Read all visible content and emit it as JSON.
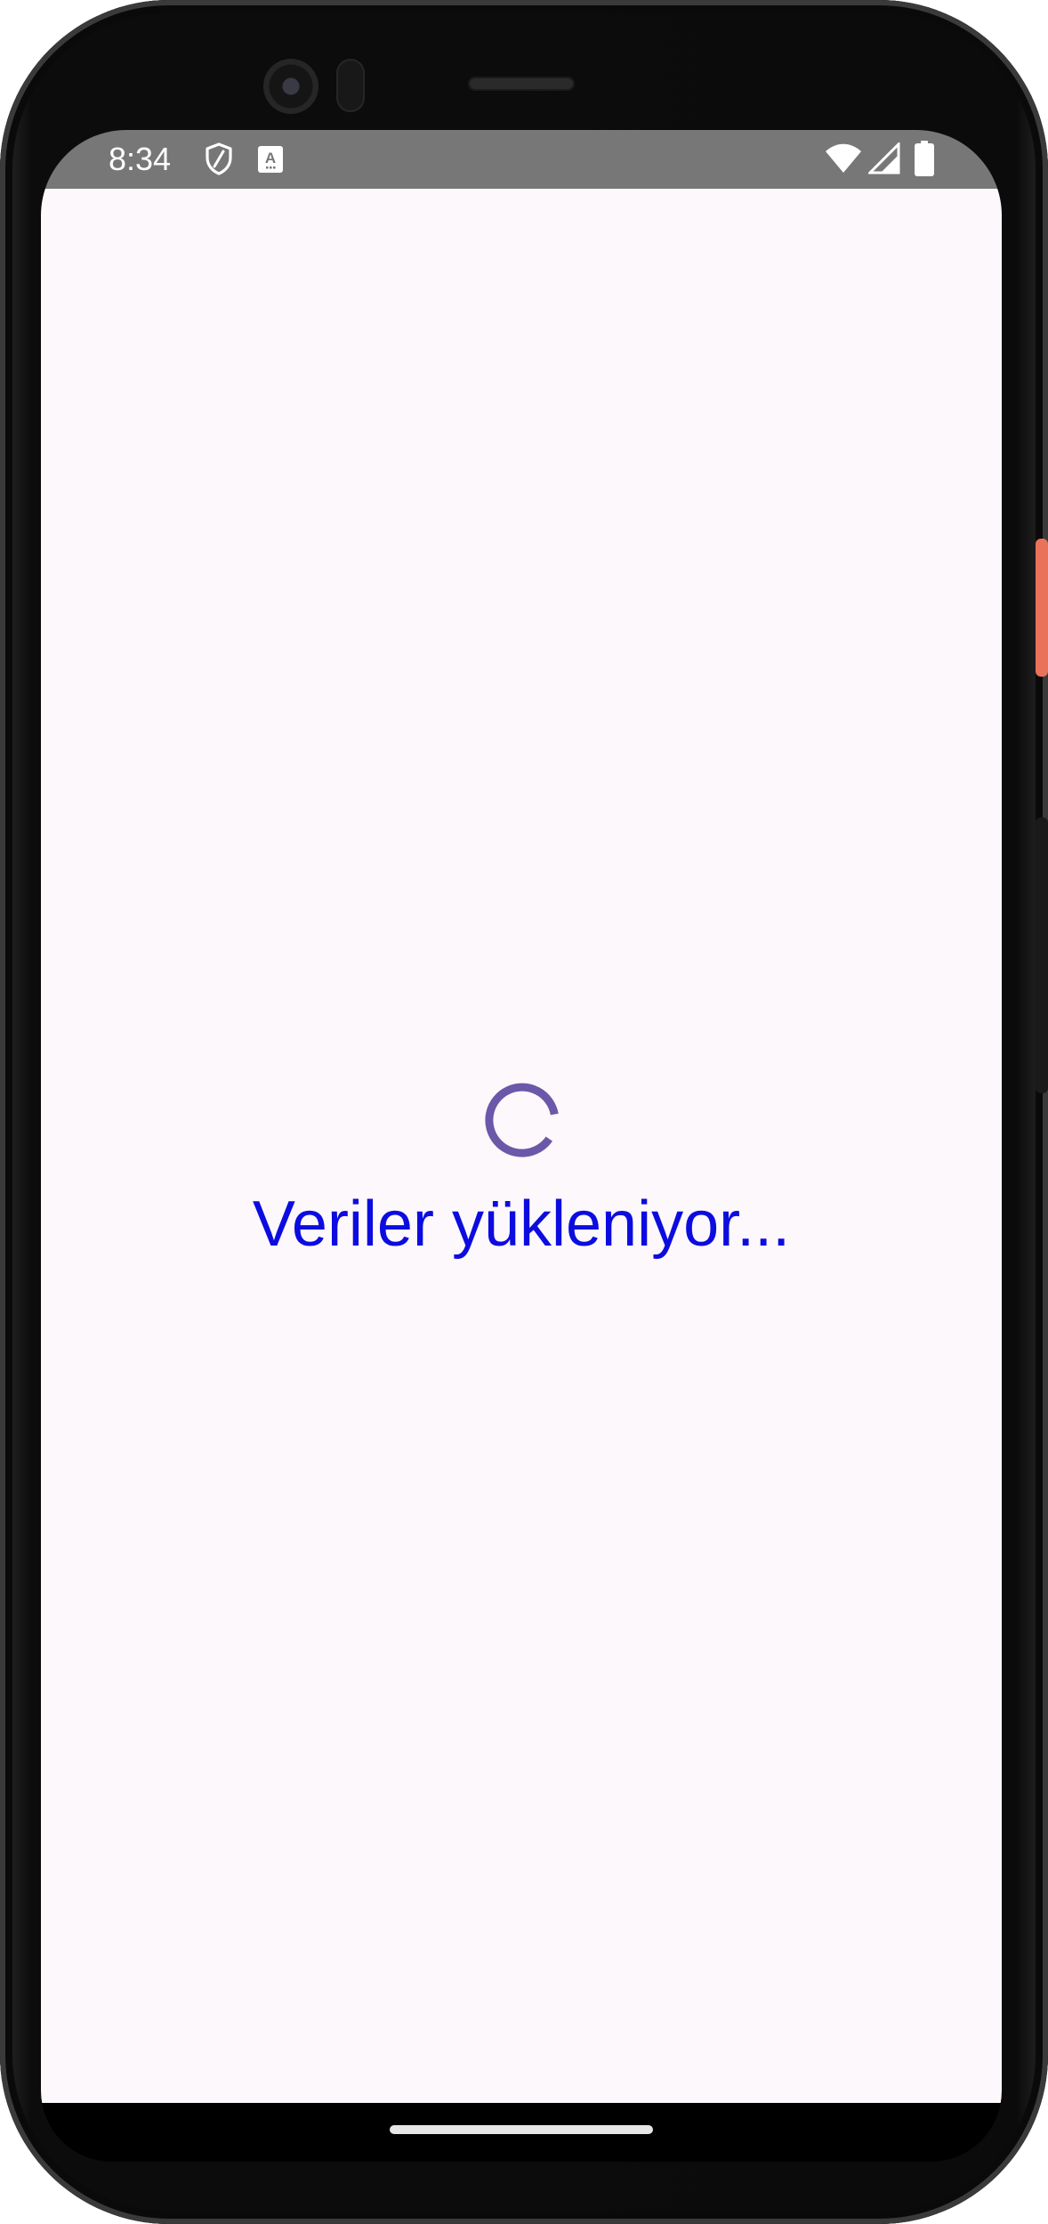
{
  "status_bar": {
    "time": "8:34",
    "left_icons": [
      "shield-icon",
      "translate-a-icon"
    ],
    "right_icons": [
      "wifi-icon",
      "cell-signal-icon",
      "battery-icon"
    ],
    "background": "#777777"
  },
  "main": {
    "loading_text": "Veriler yükleniyor...",
    "loading_text_color": "#0c0ce0",
    "spinner_color": "#6b58a8",
    "background": "#fdf8fb"
  },
  "device": {
    "frame_color": "#0b0b0b",
    "power_button_color": "#e8735a"
  }
}
